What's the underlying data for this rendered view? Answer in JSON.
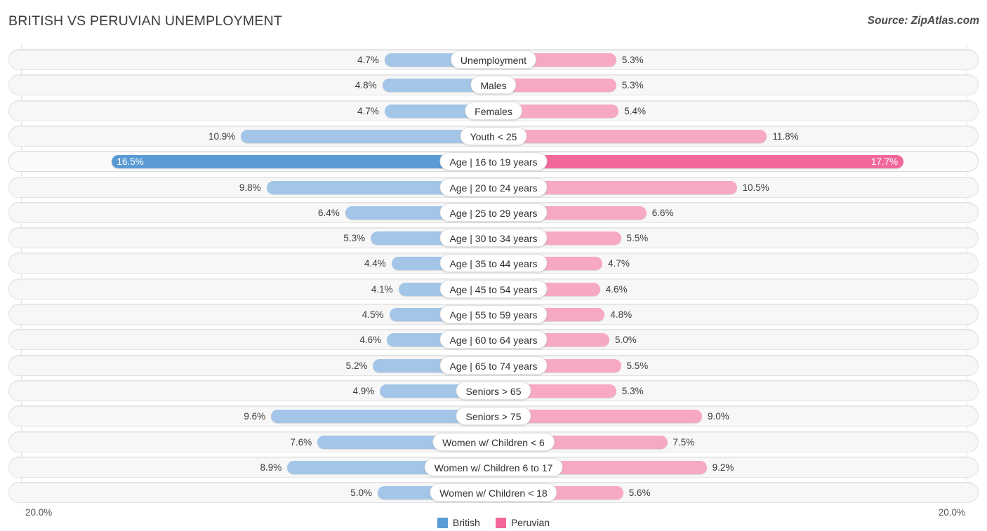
{
  "header": {
    "title": "BRITISH VS PERUVIAN UNEMPLOYMENT",
    "source": "Source: ZipAtlas.com"
  },
  "axis": {
    "left_max_label": "20.0%",
    "right_max_label": "20.0%"
  },
  "legend": [
    {
      "label": "British",
      "color": "#5b9bd5",
      "icon": "legend-swatch-british"
    },
    {
      "label": "Peruvian",
      "color": "#f2689b",
      "icon": "legend-swatch-peruvian"
    }
  ],
  "colors": {
    "british": "#a3c6e8",
    "peruvian": "#f7a8c4",
    "british_highlight": "#5b9bd5",
    "peruvian_highlight": "#f2689b",
    "track": "#f7f7f7",
    "gridline": "#e2e2e2"
  },
  "chart_data": {
    "type": "bar",
    "title": "BRITISH VS PERUVIAN UNEMPLOYMENT",
    "subtitle": "",
    "xlabel": "",
    "ylabel": "",
    "orientation": "horizontal-diverging",
    "axis_max": 20.0,
    "unit": "%",
    "grid": true,
    "legend_position": "bottom-center",
    "categories": [
      "Unemployment",
      "Males",
      "Females",
      "Youth < 25",
      "Age | 16 to 19 years",
      "Age | 20 to 24 years",
      "Age | 25 to 29 years",
      "Age | 30 to 34 years",
      "Age | 35 to 44 years",
      "Age | 45 to 54 years",
      "Age | 55 to 59 years",
      "Age | 60 to 64 years",
      "Age | 65 to 74 years",
      "Seniors > 65",
      "Seniors > 75",
      "Women w/ Children < 6",
      "Women w/ Children 6 to 17",
      "Women w/ Children < 18"
    ],
    "series": [
      {
        "name": "British",
        "values": [
          4.7,
          4.8,
          4.7,
          10.9,
          16.5,
          9.8,
          6.4,
          5.3,
          4.4,
          4.1,
          4.5,
          4.6,
          5.2,
          4.9,
          9.6,
          7.6,
          8.9,
          5.0
        ]
      },
      {
        "name": "Peruvian",
        "values": [
          5.3,
          5.3,
          5.4,
          11.8,
          17.7,
          10.5,
          6.6,
          5.5,
          4.7,
          4.6,
          4.8,
          5.0,
          5.5,
          5.3,
          9.0,
          7.5,
          9.2,
          5.6
        ]
      }
    ],
    "highlighted_row": 4
  },
  "rows": [
    {
      "label": "Unemployment",
      "left_value": "4.7%",
      "right_value": "5.3%",
      "left": 4.7,
      "right": 5.3,
      "highlight": false
    },
    {
      "label": "Males",
      "left_value": "4.8%",
      "right_value": "5.3%",
      "left": 4.8,
      "right": 5.3,
      "highlight": false
    },
    {
      "label": "Females",
      "left_value": "4.7%",
      "right_value": "5.4%",
      "left": 4.7,
      "right": 5.4,
      "highlight": false
    },
    {
      "label": "Youth < 25",
      "left_value": "10.9%",
      "right_value": "11.8%",
      "left": 10.9,
      "right": 11.8,
      "highlight": false
    },
    {
      "label": "Age | 16 to 19 years",
      "left_value": "16.5%",
      "right_value": "17.7%",
      "left": 16.5,
      "right": 17.7,
      "highlight": true
    },
    {
      "label": "Age | 20 to 24 years",
      "left_value": "9.8%",
      "right_value": "10.5%",
      "left": 9.8,
      "right": 10.5,
      "highlight": false
    },
    {
      "label": "Age | 25 to 29 years",
      "left_value": "6.4%",
      "right_value": "6.6%",
      "left": 6.4,
      "right": 6.6,
      "highlight": false
    },
    {
      "label": "Age | 30 to 34 years",
      "left_value": "5.3%",
      "right_value": "5.5%",
      "left": 5.3,
      "right": 5.5,
      "highlight": false
    },
    {
      "label": "Age | 35 to 44 years",
      "left_value": "4.4%",
      "right_value": "4.7%",
      "left": 4.4,
      "right": 4.7,
      "highlight": false
    },
    {
      "label": "Age | 45 to 54 years",
      "left_value": "4.1%",
      "right_value": "4.6%",
      "left": 4.1,
      "right": 4.6,
      "highlight": false
    },
    {
      "label": "Age | 55 to 59 years",
      "left_value": "4.5%",
      "right_value": "4.8%",
      "left": 4.5,
      "right": 4.8,
      "highlight": false
    },
    {
      "label": "Age | 60 to 64 years",
      "left_value": "4.6%",
      "right_value": "5.0%",
      "left": 4.6,
      "right": 5.0,
      "highlight": false
    },
    {
      "label": "Age | 65 to 74 years",
      "left_value": "5.2%",
      "right_value": "5.5%",
      "left": 5.2,
      "right": 5.5,
      "highlight": false
    },
    {
      "label": "Seniors > 65",
      "left_value": "4.9%",
      "right_value": "5.3%",
      "left": 4.9,
      "right": 5.3,
      "highlight": false
    },
    {
      "label": "Seniors > 75",
      "left_value": "9.6%",
      "right_value": "9.0%",
      "left": 9.6,
      "right": 9.0,
      "highlight": false
    },
    {
      "label": "Women w/ Children < 6",
      "left_value": "7.6%",
      "right_value": "7.5%",
      "left": 7.6,
      "right": 7.5,
      "highlight": false
    },
    {
      "label": "Women w/ Children 6 to 17",
      "left_value": "8.9%",
      "right_value": "9.2%",
      "left": 8.9,
      "right": 9.2,
      "highlight": false
    },
    {
      "label": "Women w/ Children < 18",
      "left_value": "5.0%",
      "right_value": "5.6%",
      "left": 5.0,
      "right": 5.6,
      "highlight": false
    }
  ]
}
